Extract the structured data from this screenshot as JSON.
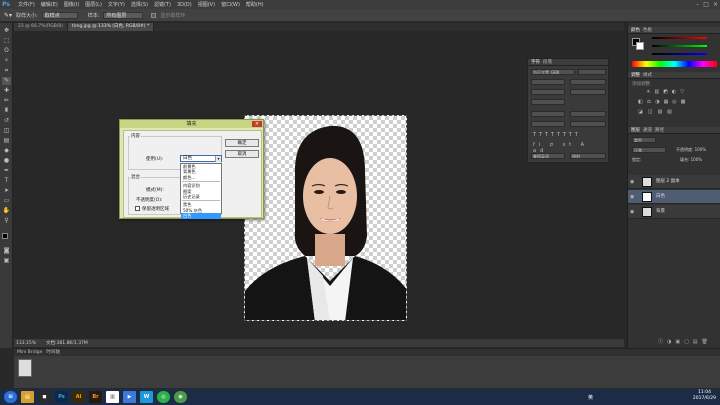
{
  "menubar": {
    "logo": "Ps",
    "items": [
      "文件(F)",
      "编辑(E)",
      "图像(I)",
      "图层(L)",
      "文字(Y)",
      "选择(S)",
      "滤镜(T)",
      "3D(D)",
      "视图(V)",
      "窗口(W)",
      "帮助(H)"
    ]
  },
  "optbar": {
    "size_label": "取样大小:",
    "size_value": "取样点",
    "sample_label": "样本:",
    "sample_value": "所有图层",
    "show_ring": "显示取样环"
  },
  "tabs": [
    {
      "label": "23 @ 66.7%(RGB/8)"
    },
    {
      "label": "timg.jpg @ 133% (白色, RGB/8#) *"
    }
  ],
  "statusbar": {
    "zoom": "133.15%",
    "doc": "文档:381.8K/1.37M"
  },
  "dialog": {
    "title": "填充",
    "contents_label": "内容",
    "use_label": "使用(U):",
    "use_value": "白色",
    "ok": "确定",
    "cancel": "取消",
    "blend_label": "混合",
    "mode_label": "模式(M):",
    "opacity_label": "不透明度(O):",
    "preserve_label": "保留透明区域",
    "dropdown": {
      "group1": [
        "前景色",
        "背景色",
        "颜色..."
      ],
      "group2": [
        "内容识别",
        "图案",
        "历史记录"
      ],
      "group3": [
        "黑色",
        "50% 灰色",
        "白色"
      ]
    }
  },
  "right": {
    "color_tabs": [
      "颜色",
      "色板"
    ],
    "adjust_tabs": [
      "调整",
      "样式"
    ],
    "adjust_hint": "添加调整",
    "layer_tabs": [
      "图层",
      "通道",
      "路径"
    ],
    "kind": "类型",
    "mode": "正常",
    "opacity": "不透明度: 100%",
    "lock": "锁定:",
    "fill": "填充: 100%",
    "layers": [
      {
        "name": "图层 2 副本",
        "active": false
      },
      {
        "name": "白色",
        "active": true
      },
      {
        "name": "背景",
        "active": false
      }
    ]
  },
  "charpanel": {
    "tabs": [
      "字符",
      "段落"
    ],
    "font": "方正大黑_GBK",
    "lang": "美国英语",
    "aa": "锐利"
  },
  "bridge": {
    "tabs": [
      "Mini Bridge",
      "时间轴"
    ]
  },
  "taskbar": {
    "lang": "英",
    "time": "11:04",
    "date": "2017/6/29"
  },
  "colors": {
    "accent": "#4aa3df",
    "dialog_bg": "#dfe7b8",
    "dialog_title": "#c6d483",
    "selected_item": "#3399ff",
    "active_layer": "#505c72"
  }
}
